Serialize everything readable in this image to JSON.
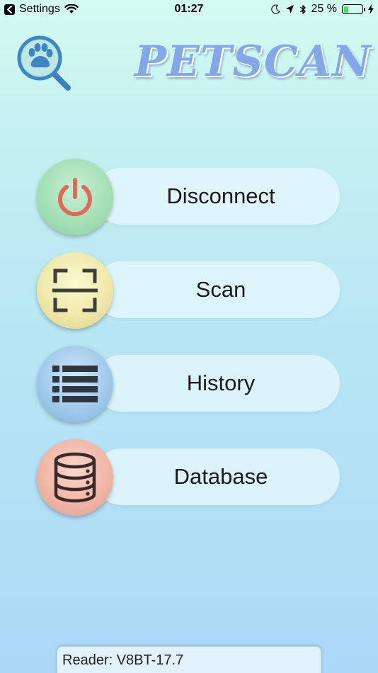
{
  "status_bar": {
    "back_app": "Settings",
    "time": "01:27",
    "battery_text": "25 %",
    "battery_level": 0.25
  },
  "header": {
    "title": "PETSCAN",
    "logo_icon": "paw-magnifier-icon"
  },
  "menu": {
    "items": [
      {
        "label": "Disconnect",
        "icon": "power-icon",
        "color": "#e26b5a"
      },
      {
        "label": "Scan",
        "icon": "scan-frame-icon",
        "color": "#3d3d3d"
      },
      {
        "label": "History",
        "icon": "list-icon",
        "color": "#2f3640"
      },
      {
        "label": "Database",
        "icon": "database-icon",
        "color": "#3a2a28"
      }
    ]
  },
  "footer": {
    "reader_text": "Reader: V8BT-17.7"
  },
  "colors": {
    "title": "#84a7ea",
    "background_top": "#d4fbef",
    "background_bottom": "#acd8f7"
  }
}
